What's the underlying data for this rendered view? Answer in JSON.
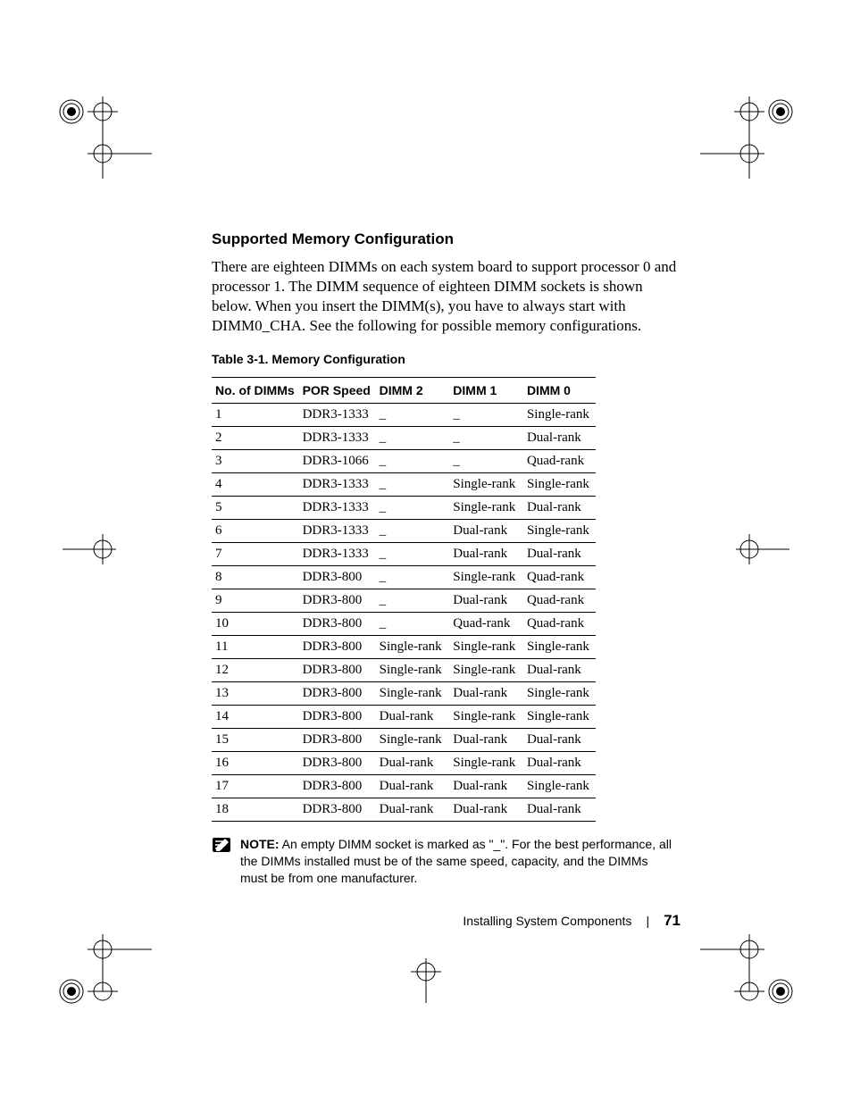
{
  "heading": "Supported Memory Configuration",
  "paragraph": "There are eighteen DIMMs on each system board to support processor 0 and processor 1. The DIMM sequence of eighteen DIMM sockets is shown below. When you insert the DIMM(s), you have to always start with DIMM0_CHA. See the following for possible memory configurations.",
  "table": {
    "caption": "Table 3-1.   Memory Configuration",
    "headers": [
      "No. of DIMMs",
      "POR Speed",
      "DIMM 2",
      "DIMM 1",
      "DIMM 0"
    ],
    "rows": [
      [
        "1",
        "DDR3-1333",
        "_",
        "_",
        "Single-rank"
      ],
      [
        "2",
        "DDR3-1333",
        "_",
        "_",
        "Dual-rank"
      ],
      [
        "3",
        "DDR3-1066",
        "_",
        "_",
        "Quad-rank"
      ],
      [
        "4",
        "DDR3-1333",
        "_",
        "Single-rank",
        "Single-rank"
      ],
      [
        "5",
        "DDR3-1333",
        "_",
        "Single-rank",
        "Dual-rank"
      ],
      [
        "6",
        "DDR3-1333",
        "_",
        "Dual-rank",
        "Single-rank"
      ],
      [
        "7",
        "DDR3-1333",
        "_",
        "Dual-rank",
        "Dual-rank"
      ],
      [
        "8",
        "DDR3-800",
        "_",
        "Single-rank",
        "Quad-rank"
      ],
      [
        "9",
        "DDR3-800",
        "_",
        "Dual-rank",
        "Quad-rank"
      ],
      [
        "10",
        "DDR3-800",
        "_",
        "Quad-rank",
        "Quad-rank"
      ],
      [
        "11",
        "DDR3-800",
        "Single-rank",
        "Single-rank",
        "Single-rank"
      ],
      [
        "12",
        "DDR3-800",
        "Single-rank",
        "Single-rank",
        "Dual-rank"
      ],
      [
        "13",
        "DDR3-800",
        "Single-rank",
        "Dual-rank",
        "Single-rank"
      ],
      [
        "14",
        "DDR3-800",
        "Dual-rank",
        "Single-rank",
        "Single-rank"
      ],
      [
        "15",
        "DDR3-800",
        "Single-rank",
        "Dual-rank",
        "Dual-rank"
      ],
      [
        "16",
        "DDR3-800",
        "Dual-rank",
        "Single-rank",
        "Dual-rank"
      ],
      [
        "17",
        "DDR3-800",
        "Dual-rank",
        "Dual-rank",
        "Single-rank"
      ],
      [
        "18",
        "DDR3-800",
        "Dual-rank",
        "Dual-rank",
        "Dual-rank"
      ]
    ]
  },
  "note": {
    "label": "NOTE:",
    "text": " An empty DIMM socket is marked as \"_\". For the best performance, all the DIMMs installed must be of the same speed, capacity, and the DIMMs must be from one manufacturer."
  },
  "footer": {
    "section": "Installing System Components",
    "page": "71"
  }
}
